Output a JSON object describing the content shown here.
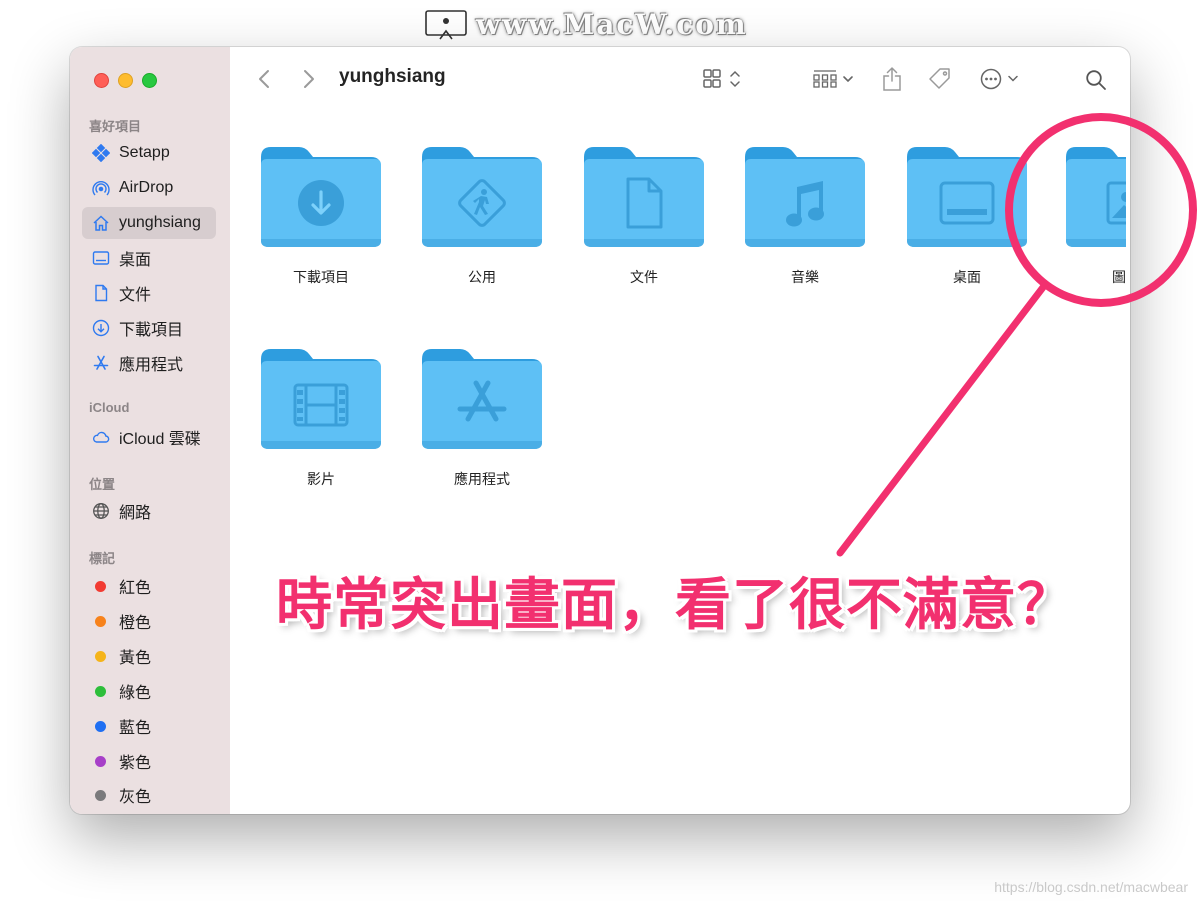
{
  "watermark": {
    "text": "www.MacW.com"
  },
  "window": {
    "title": "yunghsiang",
    "traffic_lights": {
      "close": "#ff5f57",
      "minimize": "#febc2e",
      "zoom": "#28c840"
    }
  },
  "sidebar": {
    "favorites_header": "喜好項目",
    "favorites": [
      {
        "label": "Setapp",
        "icon": "setapp-icon"
      },
      {
        "label": "AirDrop",
        "icon": "airdrop-icon"
      },
      {
        "label": "yunghsiang",
        "icon": "home-icon",
        "selected": true
      },
      {
        "label": "桌面",
        "icon": "desktop-icon"
      },
      {
        "label": "文件",
        "icon": "document-icon"
      },
      {
        "label": "下載項目",
        "icon": "download-icon"
      },
      {
        "label": "應用程式",
        "icon": "applications-icon"
      }
    ],
    "icloud_header": "iCloud",
    "icloud": [
      {
        "label": "iCloud 雲碟",
        "icon": "cloud-icon"
      }
    ],
    "locations_header": "位置",
    "locations": [
      {
        "label": "網路",
        "icon": "globe-icon"
      }
    ],
    "tags_header": "標記",
    "tags": [
      {
        "label": "紅色",
        "color": "#f23b32"
      },
      {
        "label": "橙色",
        "color": "#f7821b"
      },
      {
        "label": "黃色",
        "color": "#f5b41a"
      },
      {
        "label": "綠色",
        "color": "#2dbe3a"
      },
      {
        "label": "藍色",
        "color": "#1f6ff2"
      },
      {
        "label": "紫色",
        "color": "#a73fc8"
      },
      {
        "label": "灰色",
        "color": "#7a7a7c"
      }
    ]
  },
  "folders": [
    {
      "label": "下載項目",
      "glyph": "download-glyph"
    },
    {
      "label": "公用",
      "glyph": "public-glyph"
    },
    {
      "label": "文件",
      "glyph": "document-glyph"
    },
    {
      "label": "音樂",
      "glyph": "music-glyph"
    },
    {
      "label": "桌面",
      "glyph": "desktop-glyph"
    },
    {
      "label": "圖",
      "glyph": "pictures-glyph"
    },
    {
      "label": "影片",
      "glyph": "movies-glyph"
    },
    {
      "label": "應用程式",
      "glyph": "applications-glyph"
    }
  ],
  "annotation": {
    "caption": "時常突出畫面，看了很不滿意？",
    "color": "#f2306f"
  },
  "credit": "https://blog.csdn.net/macwbear",
  "folder_color": "#5ec0f5"
}
